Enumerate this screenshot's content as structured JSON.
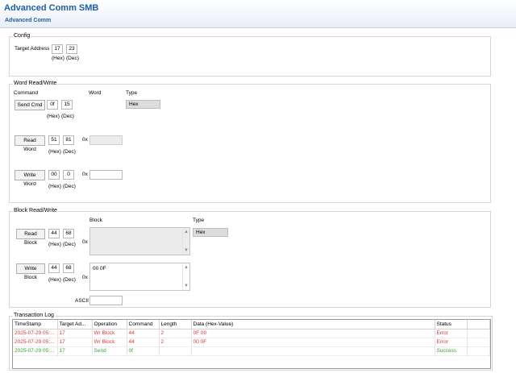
{
  "app": {
    "title": "Advanced Comm SMB",
    "tab": "Advanced Comm"
  },
  "config": {
    "title": "Config",
    "target_label": "Target Address",
    "target_hex": "17",
    "target_dec": "23",
    "hex_label": "(Hex)",
    "dec_label": "(Dec)"
  },
  "word": {
    "title": "Word Read/Write",
    "col_command": "Command",
    "col_word": "Word",
    "col_type": "Type",
    "type_value": "Hex",
    "prefix": "0x",
    "hex_label": "(Hex)",
    "dec_label": "(Dec)",
    "send": {
      "label": "Send Cmd",
      "hex": "0f",
      "dec": "15"
    },
    "read": {
      "label": "Read Word",
      "hex": "51",
      "dec": "81",
      "word": ""
    },
    "write": {
      "label": "Write Word",
      "hex": "00",
      "dec": "0",
      "word": ""
    }
  },
  "block": {
    "title": "Block Read/Write",
    "col_block": "Block",
    "col_type": "Type",
    "type_value": "Hex",
    "prefix": "0x",
    "hex_label": "(Hex)",
    "dec_label": "(Dec)",
    "read": {
      "label": "Read Block",
      "hex": "44",
      "dec": "68",
      "data": ""
    },
    "write": {
      "label": "Write Block",
      "hex": "44",
      "dec": "68",
      "data": "00 0F"
    },
    "ascii_label": "ASCII",
    "ascii_value": ""
  },
  "log": {
    "title": "Transaction Log",
    "headers": [
      "TimeStamp",
      "Target Ad...",
      "Operation",
      "Command",
      "Length",
      "Data (Hex-Value)",
      "Status"
    ],
    "rows": [
      [
        "2025-07-29 05:...",
        "17",
        "Wr Block",
        "44",
        "2",
        "0F 00",
        "Error"
      ],
      [
        "2025-07-29 05:...",
        "17",
        "Wr Block",
        "44",
        "2",
        "00 0F",
        "Error"
      ],
      [
        "2025-07-29 05:...",
        "17",
        "Send",
        "0f",
        "",
        "",
        "Success"
      ]
    ],
    "row_status": [
      "error",
      "error",
      "success"
    ],
    "colors": {
      "error": "#d9382f",
      "success": "#3aa335"
    }
  }
}
